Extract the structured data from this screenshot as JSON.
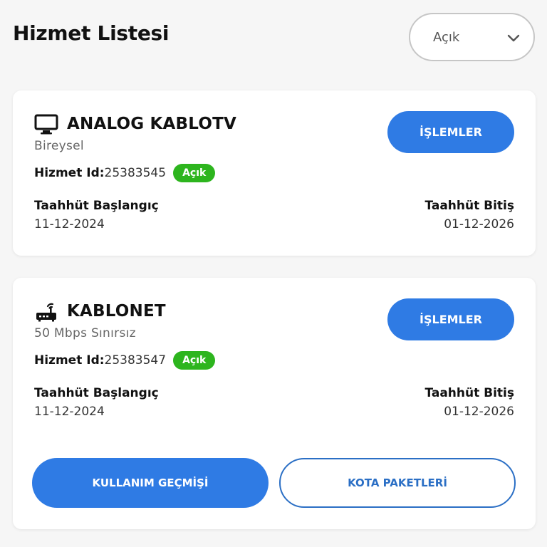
{
  "header": {
    "title": "Hizmet Listesi",
    "filter": {
      "selected": "Açık",
      "icon": "chevron-down-icon"
    }
  },
  "services": [
    {
      "icon": "tv-icon",
      "name": "ANALOG KABLOTV",
      "subtitle": "Bireysel",
      "id_label": "Hizmet Id:",
      "id_value": "25383545",
      "status": "Açık",
      "action_label": "İŞLEMLER",
      "start_label": "Taahhüt Başlangıç",
      "start_value": "11-12-2024",
      "end_label": "Taahhüt Bitiş",
      "end_value": "01-12-2026"
    },
    {
      "icon": "router-icon",
      "name": "KABLONET",
      "subtitle": "50 Mbps Sınırsız",
      "id_label": "Hizmet Id:",
      "id_value": "25383547",
      "status": "Açık",
      "action_label": "İŞLEMLER",
      "start_label": "Taahhüt Başlangıç",
      "start_value": "11-12-2024",
      "end_label": "Taahhüt Bitiş",
      "end_value": "01-12-2026",
      "usage_label": "KULLANIM GEÇMİŞİ",
      "quota_label": "KOTA PAKETLERİ"
    }
  ],
  "colors": {
    "primary": "#2f7be4",
    "status_open": "#2db51e",
    "background": "#f6f6f6"
  }
}
